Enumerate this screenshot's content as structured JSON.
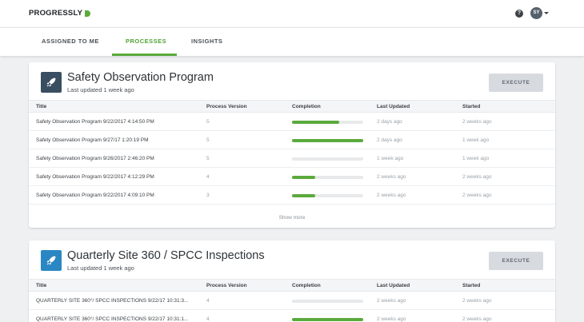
{
  "app": {
    "logo_text": "PROGRESSLY",
    "brand_color": "#5aaa3c"
  },
  "header": {
    "help_icon_glyph": "?",
    "user_initials": "SY"
  },
  "tabs": [
    {
      "label": "ASSIGNED TO ME",
      "active": false
    },
    {
      "label": "PROCESSES",
      "active": true
    },
    {
      "label": "INSIGHTS",
      "active": false
    }
  ],
  "columns": [
    "Title",
    "Process Version",
    "Completion",
    "Last Updated",
    "Started"
  ],
  "processes": [
    {
      "title": "Safety Observation Program",
      "subtitle": "Last updated 1 week ago",
      "icon": "rocket-icon",
      "execute_label": "EXECUTE",
      "rows": [
        {
          "title": "Safety Observation Program 9/22/2017 4:14:50 PM",
          "version": "5",
          "completion": 0.66,
          "last_updated": "2 days ago",
          "started": "2 weeks ago"
        },
        {
          "title": "Safety Observation Program 9/27/17 1:20:19 PM",
          "version": "5",
          "completion": 1.0,
          "last_updated": "2 days ago",
          "started": "1 week ago"
        },
        {
          "title": "Safety Observation Program 9/26/2017 2:46:20 PM",
          "version": "5",
          "completion": 0.0,
          "last_updated": "1 week ago",
          "started": "1 week ago"
        },
        {
          "title": "Safety Observation Program 9/22/2017 4:12:29 PM",
          "version": "4",
          "completion": 0.33,
          "last_updated": "2 weeks ago",
          "started": "2 weeks ago"
        },
        {
          "title": "Safety Observation Program 9/22/2017 4:09:10 PM",
          "version": "3",
          "completion": 0.33,
          "last_updated": "2 weeks ago",
          "started": "2 weeks ago"
        }
      ],
      "show_more_label": "Show more"
    },
    {
      "title": "Quarterly Site 360 / SPCC Inspections",
      "subtitle": "Last updated 1 week ago",
      "icon": "rocket-icon",
      "execute_label": "EXECUTE",
      "rows": [
        {
          "title": "QUARTERLY SITE 360°/ SPCC INSPECTIONS 9/22/17 10:31:3...",
          "version": "4",
          "completion": 0.0,
          "last_updated": "2 weeks ago",
          "started": "2 weeks ago"
        },
        {
          "title": "QUARTERLY SITE 360°/ SPCC INSPECTIONS 9/22/17 10:31:1...",
          "version": "4",
          "completion": 1.0,
          "last_updated": "2 weeks ago",
          "started": "2 weeks ago"
        }
      ]
    }
  ]
}
